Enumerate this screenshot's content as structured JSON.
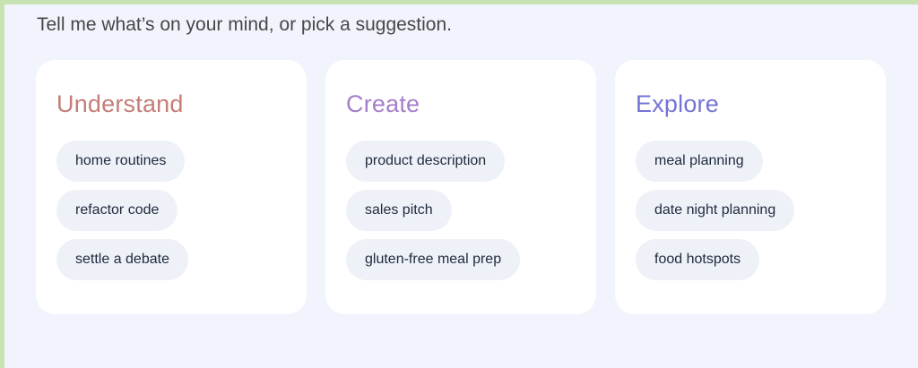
{
  "prompt": "Tell me what’s on your mind, or pick a suggestion.",
  "cards": [
    {
      "title": "Understand",
      "chips": [
        "home routines",
        "refactor code",
        "settle a debate"
      ]
    },
    {
      "title": "Create",
      "chips": [
        "product description",
        "sales pitch",
        "gluten-free meal prep"
      ]
    },
    {
      "title": "Explore",
      "chips": [
        "meal planning",
        "date night planning",
        "food hotspots"
      ]
    }
  ],
  "colors": {
    "understand": "#c57d78",
    "create": "#a47fc9",
    "explore": "#7474d6",
    "page_background": "#f1f4fc",
    "outer_border": "#c8e3b3",
    "chip_background": "#eef1f8"
  }
}
